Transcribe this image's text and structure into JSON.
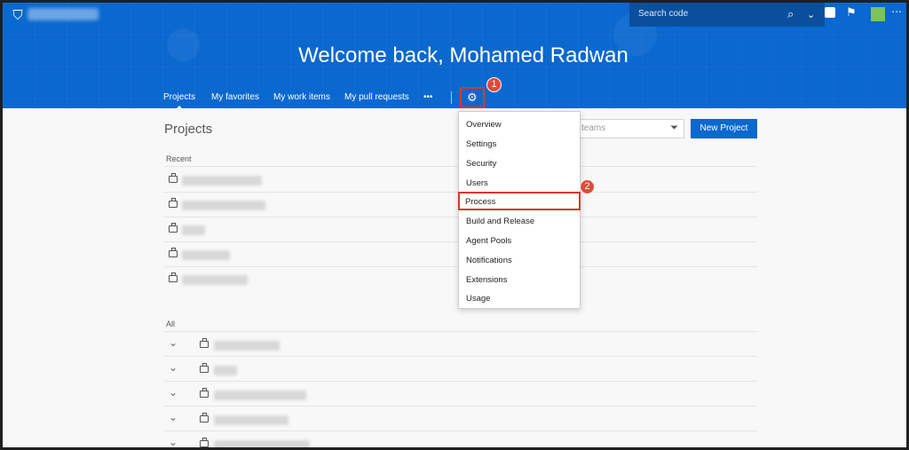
{
  "header": {
    "search_placeholder": "Search code",
    "welcome": "Welcome back, Mohamed Radwan",
    "nav": [
      {
        "label": "Projects",
        "active": true
      },
      {
        "label": "My favorites"
      },
      {
        "label": "My work items"
      },
      {
        "label": "My pull requests"
      },
      {
        "label": "•••"
      }
    ],
    "icons": [
      "vsts-logo-icon",
      "search-icon",
      "chevron-down-icon",
      "shopping-bag-icon",
      "flag-icon",
      "avatar",
      "more-icon",
      "gear-icon"
    ]
  },
  "callouts": {
    "one": "1",
    "two": "2"
  },
  "main": {
    "title": "Projects",
    "filter_placeholder": "teams",
    "new_project": "New Project",
    "recent_label": "Recent",
    "all_label": "All"
  },
  "settings_menu": {
    "items": [
      "Overview",
      "Settings",
      "Security",
      "Users",
      "Process",
      "Build and Release",
      "Agent Pools",
      "Notifications",
      "Extensions",
      "Usage"
    ],
    "highlighted": "Process"
  },
  "colors": {
    "brand_blue": "#0a68cf",
    "callout_red": "#d9372f",
    "page_bg": "#f8f8f8"
  }
}
